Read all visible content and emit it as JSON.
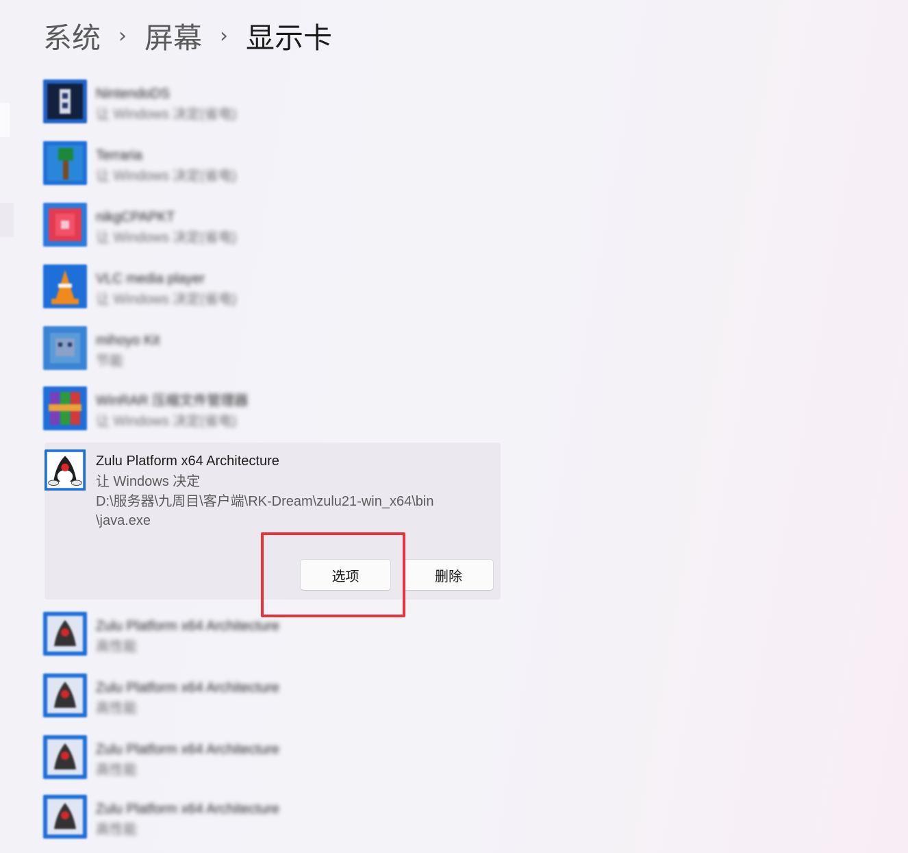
{
  "breadcrumb": {
    "items": [
      "系统",
      "屏幕",
      "显示卡"
    ],
    "separator": "›"
  },
  "apps": [
    {
      "icon": "nintendo-ds-emulator-icon",
      "name": "NintendoDS",
      "sub": "让 Windows 决定(省电)"
    },
    {
      "icon": "terraria-tree-icon",
      "name": "Terraria",
      "sub": "让 Windows 决定(省电)"
    },
    {
      "icon": "heart-game-icon",
      "name": "nikgCPAPKT",
      "sub": "让 Windows 决定(省电)"
    },
    {
      "icon": "vlc-cone-icon",
      "name": "VLC media player",
      "sub": "让 Windows 决定(省电)"
    },
    {
      "icon": "robot-app-icon",
      "name": "mihoyo Kit",
      "sub": "节能"
    },
    {
      "icon": "winrar-books-icon",
      "name": "WinRAR 压缩文件管理器",
      "sub": "让 Windows 决定(省电)"
    }
  ],
  "selected_app": {
    "icon": "java-duke-icon",
    "name": "Zulu Platform x64 Architecture",
    "preference": "让 Windows 决定",
    "path": "D:\\服务器\\九周目\\客户端\\RK-Dream\\zulu21-win_x64\\bin\n\\java.exe",
    "options_label": "选项",
    "delete_label": "删除"
  },
  "apps_after": [
    {
      "icon": "java-duke-icon",
      "name": "Zulu Platform x64 Architecture",
      "sub": "高性能"
    },
    {
      "icon": "java-duke-icon",
      "name": "Zulu Platform x64 Architecture",
      "sub": "高性能"
    },
    {
      "icon": "java-duke-icon",
      "name": "Zulu Platform x64 Architecture",
      "sub": "高性能"
    },
    {
      "icon": "java-duke-icon",
      "name": "Zulu Platform x64 Architecture",
      "sub": "高性能"
    }
  ],
  "colors": {
    "highlight": "#e8323c",
    "icon_border": "#1e6fd9"
  }
}
